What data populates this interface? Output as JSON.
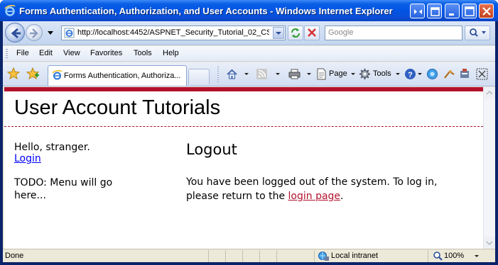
{
  "window": {
    "title": "Forms Authentication, Authorization, and User Accounts - Windows Internet Explorer"
  },
  "address_bar": {
    "url": "http://localhost:4452/ASPNET_Security_Tutorial_02_CS",
    "search_placeholder": "Google"
  },
  "menu": {
    "items": [
      "File",
      "Edit",
      "View",
      "Favorites",
      "Tools",
      "Help"
    ]
  },
  "tabs": [
    {
      "label": "Forms Authentication, Authoriza..."
    }
  ],
  "command_bar": {
    "page_label": "Page",
    "tools_label": "Tools"
  },
  "page": {
    "site_title": "User Account Tutorials",
    "greeting": "Hello, stranger.",
    "login_link": "Login",
    "todo": "TODO: Menu will go here...",
    "heading": "Logout",
    "message_before": "You have been logged out of the system. To log in, please return to the ",
    "message_link": "login page",
    "message_after": ".",
    "accent_color": "#b2112c"
  },
  "status_bar": {
    "status": "Done",
    "zone": "Local intranet",
    "zoom": "100%"
  },
  "icons": [
    "ie-logo-icon",
    "back-arrow-icon",
    "forward-arrow-icon",
    "refresh-icon",
    "stop-icon",
    "search-icon",
    "favorites-star-icon",
    "add-favorites-icon",
    "home-icon",
    "feeds-icon",
    "print-icon",
    "page-icon",
    "tools-gear-icon",
    "help-icon",
    "globe-icon",
    "zone-icon",
    "zoom-icon"
  ]
}
